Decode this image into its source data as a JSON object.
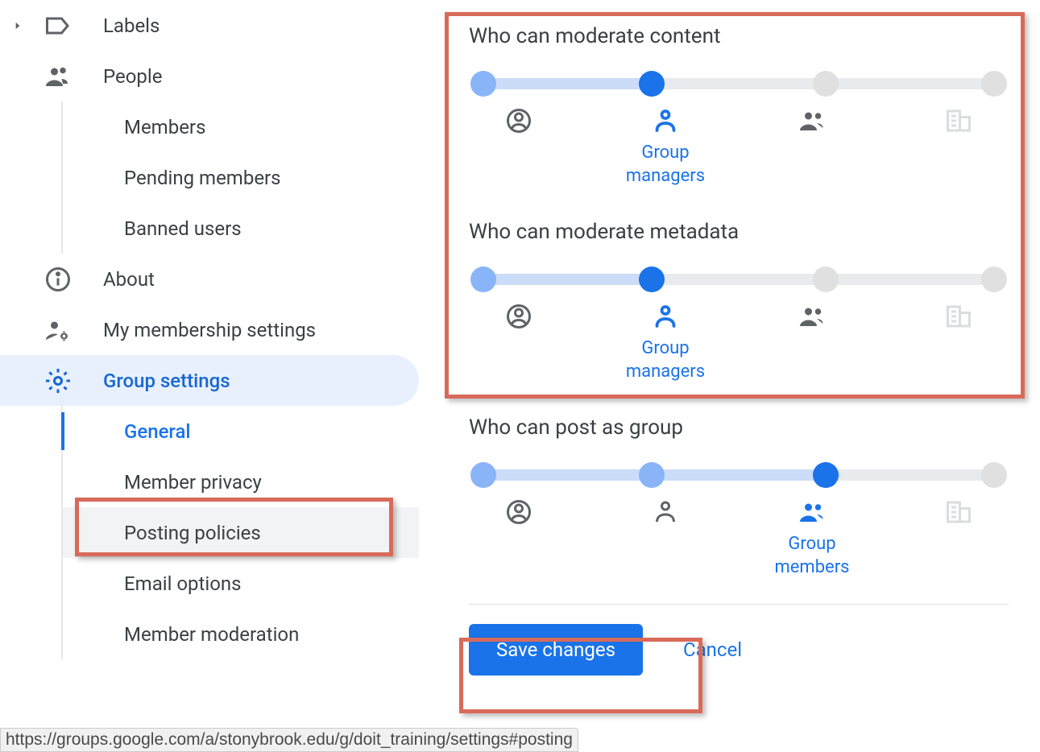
{
  "sidebar": {
    "labels": "Labels",
    "people": "People",
    "people_sub": {
      "members": "Members",
      "pending": "Pending members",
      "banned": "Banned users"
    },
    "about": "About",
    "membership": "My membership settings",
    "group_settings": "Group settings",
    "gs_sub": {
      "general": "General",
      "privacy": "Member privacy",
      "posting": "Posting policies",
      "email": "Email options",
      "moderation": "Member moderation"
    }
  },
  "settings": {
    "moderate_content": {
      "title": "Who can moderate content",
      "selected_label": "Group managers",
      "selected_index": 1,
      "stop_count": 4
    },
    "moderate_metadata": {
      "title": "Who can moderate metadata",
      "selected_label": "Group managers",
      "selected_index": 1,
      "stop_count": 4
    },
    "post_as_group": {
      "title": "Who can post as group",
      "selected_label": "Group members",
      "selected_index": 2,
      "stop_count": 4
    }
  },
  "buttons": {
    "save": "Save changes",
    "cancel": "Cancel"
  },
  "status_url": "https://groups.google.com/a/stonybrook.edu/g/doit_training/settings#posting"
}
